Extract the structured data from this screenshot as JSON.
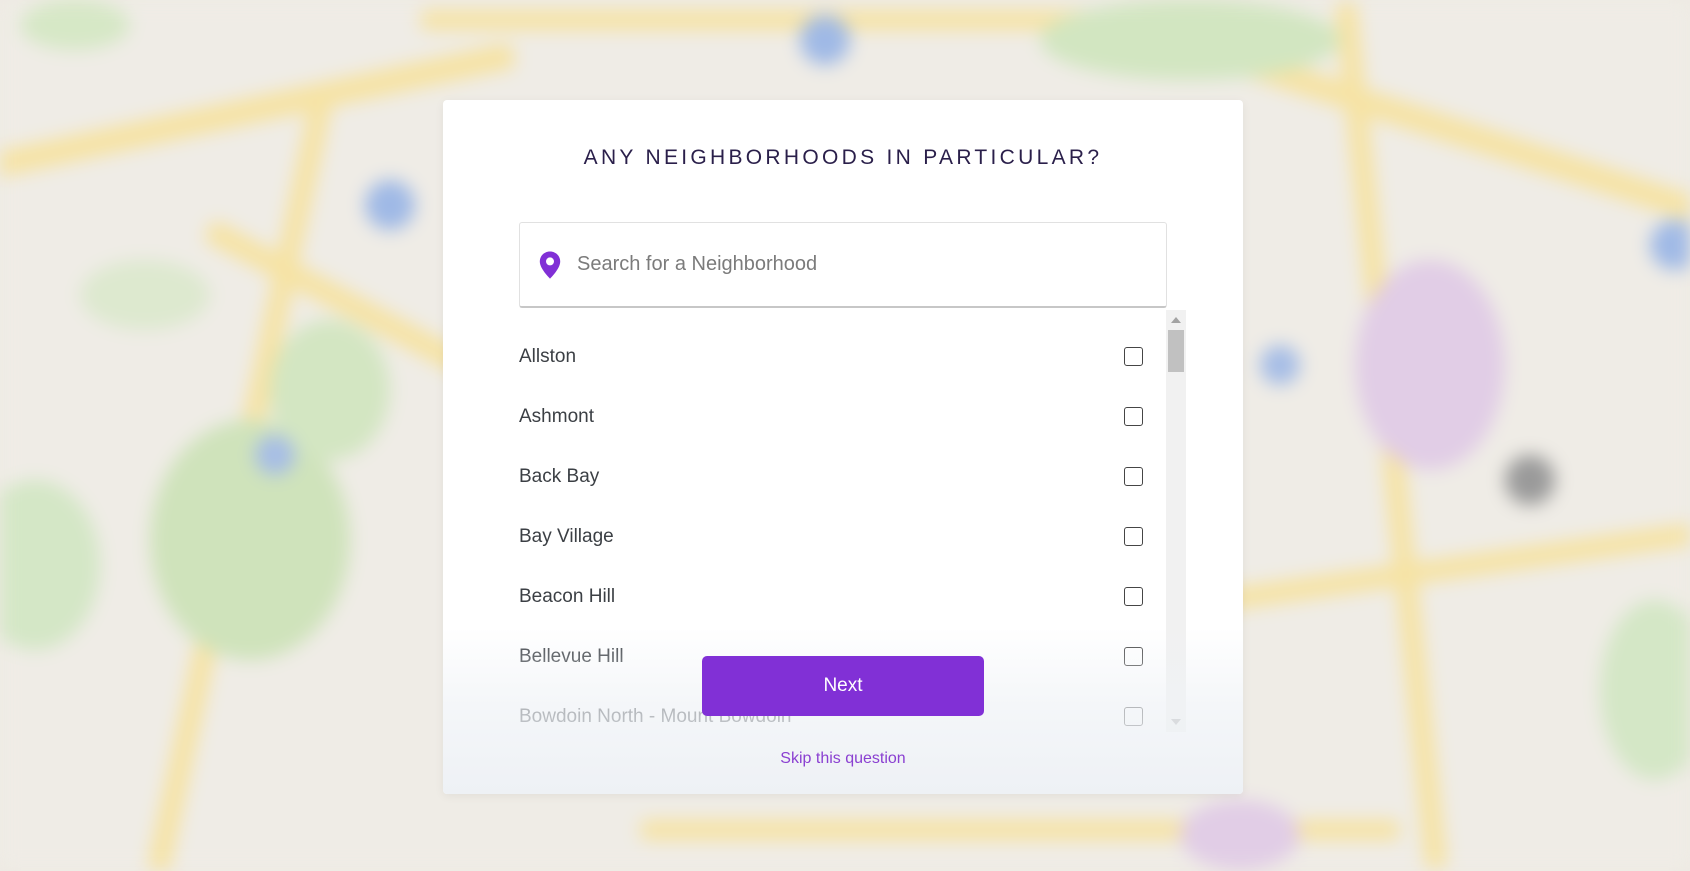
{
  "modal": {
    "title": "ANY NEIGHBORHOODS IN PARTICULAR?",
    "search_placeholder": "Search for a Neighborhood",
    "search_value": "",
    "neighborhoods": [
      {
        "label": "Allston",
        "checked": false
      },
      {
        "label": "Ashmont",
        "checked": false
      },
      {
        "label": "Back Bay",
        "checked": false
      },
      {
        "label": "Bay Village",
        "checked": false
      },
      {
        "label": "Beacon Hill",
        "checked": false
      },
      {
        "label": "Bellevue Hill",
        "checked": false
      },
      {
        "label": "Bowdoin North - Mount Bowdoin",
        "checked": false
      }
    ],
    "next_label": "Next",
    "skip_label": "Skip this question"
  },
  "colors": {
    "accent": "#8130d6",
    "link": "#8a3fd1",
    "title": "#2a1f4a",
    "item_text": "#3b3f44"
  },
  "icons": {
    "search": "map-pin-icon",
    "scroll_up": "scroll-up-arrow-icon",
    "scroll_down": "scroll-down-arrow-icon"
  }
}
